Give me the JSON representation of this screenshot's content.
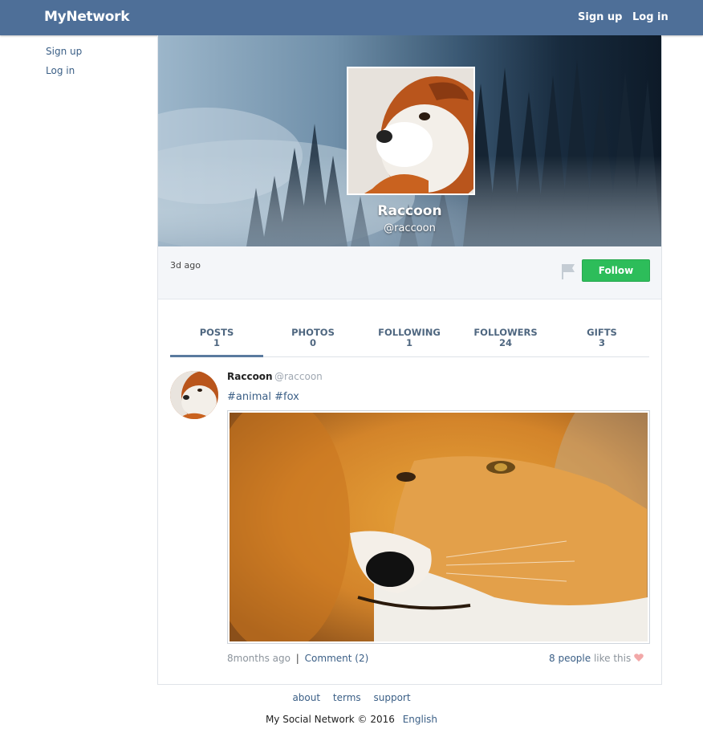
{
  "header": {
    "brand": "MyNetwork",
    "signup_label": "Sign up",
    "login_label": "Log in"
  },
  "sidebar": {
    "items": [
      {
        "label": "Sign up"
      },
      {
        "label": "Log in"
      }
    ]
  },
  "profile": {
    "name": "Raccoon",
    "handle": "@raccoon",
    "last_active": "3d ago",
    "follow_label": "Follow",
    "flag_icon": "flag-icon"
  },
  "tabs": [
    {
      "label": "POSTS",
      "count": "1",
      "active": true
    },
    {
      "label": "PHOTOS",
      "count": "0"
    },
    {
      "label": "FOLLOWING",
      "count": "1"
    },
    {
      "label": "FOLLOWERS",
      "count": "24"
    },
    {
      "label": "GIFTS",
      "count": "3"
    }
  ],
  "post": {
    "author": "Raccoon",
    "handle": "@raccoon",
    "tags": [
      "#animal",
      "#fox"
    ],
    "time": "8months ago",
    "separator": "|",
    "comment_label": "Comment (2)",
    "likes_count": "8 people",
    "likes_suffix": "like this",
    "heart_icon": "heart-icon"
  },
  "footer": {
    "links": [
      "about",
      "terms",
      "support"
    ],
    "copyright": "My Social Network © 2016",
    "language": "English"
  },
  "colors": {
    "header_bg": "#4e6f98",
    "follow_green": "#2dbd5a",
    "link_blue": "#3b5f86",
    "heart_pink": "#f2a8a8"
  }
}
